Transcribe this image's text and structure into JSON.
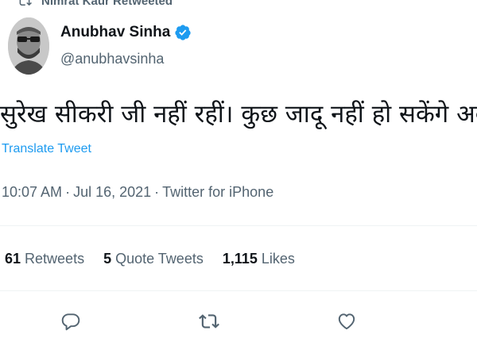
{
  "retweet_notice": {
    "text": "Nimrat Kaur Retweeted",
    "icon": "retweet-icon"
  },
  "author": {
    "name": "Anubhav Sinha",
    "handle": "@anubhavsinha",
    "verified_icon": "verified-badge-icon",
    "avatar": "avatar-photo"
  },
  "tweet": {
    "text": "सुरेख सीकरी जी नहीं रहीं। कुछ जादू नहीं हो सकेंगे अब।",
    "translate_label": "Translate Tweet",
    "time": "10:07 AM",
    "sep1": "·",
    "date": "Jul 16, 2021",
    "sep2": "·",
    "source": "Twitter for iPhone"
  },
  "stats": [
    {
      "value": "61",
      "label": "Retweets"
    },
    {
      "value": "5",
      "label": "Quote Tweets"
    },
    {
      "value": "1,115",
      "label": "Likes"
    }
  ],
  "actions": [
    {
      "name": "reply",
      "icon": "reply-icon"
    },
    {
      "name": "retweet",
      "icon": "retweet-icon"
    },
    {
      "name": "like",
      "icon": "heart-icon"
    }
  ],
  "colors": {
    "accent": "#1d9bf0",
    "text": "#0f1419",
    "muted": "#536471",
    "divider": "#eff3f4"
  }
}
